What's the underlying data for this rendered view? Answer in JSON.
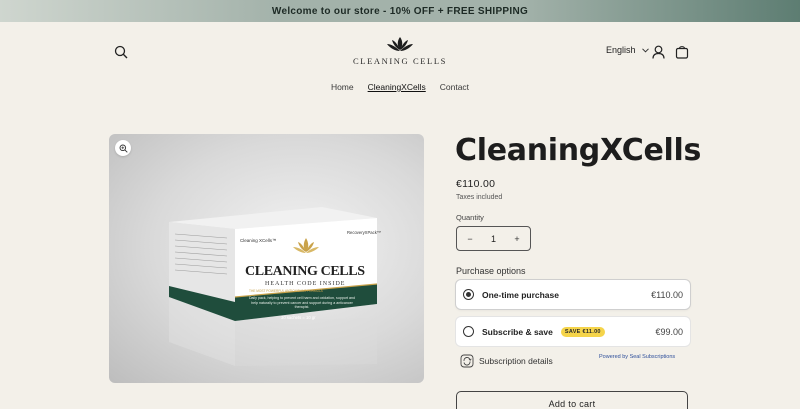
{
  "announcement": "Welcome to our store - 10% OFF + FREE SHIPPING",
  "header": {
    "logo_text": "CLEANING CELLS",
    "language": "English"
  },
  "nav": {
    "items": [
      {
        "label": "Home"
      },
      {
        "label": "CleaningXCells"
      },
      {
        "label": "Contact"
      }
    ],
    "active_index": 1
  },
  "product": {
    "title": "CleaningXCells",
    "price": "€110.00",
    "taxes_note": "Taxes included",
    "quantity_label": "Quantity",
    "quantity": "1",
    "decrease_symbol": "−",
    "increase_symbol": "+",
    "image": {
      "brand_small": "Cleaning XCells™",
      "pack_name": "RecoveryXPack™",
      "main_name": "CLEANING CELLS",
      "subtitle": "HEALTH CODE INSIDE",
      "tagline": "THE MOST POWERFUL ANTIOXIDANT FORMULA",
      "description": "Daily pack, helping to prevent cell harm and oxidation, support and help naturally to prevent cancer and support during a anticancer therapist.",
      "contents": "30 sachets = 10 gr"
    }
  },
  "purchase_options": {
    "label": "Purchase options",
    "one_time": {
      "name": "One-time purchase",
      "price": "€110.00",
      "selected": true
    },
    "subscribe": {
      "name": "Subscribe & save",
      "badge": "SAVE €11.00",
      "price": "€99.00",
      "selected": false
    },
    "subscription_details": "Subscription details",
    "powered_by": "Powered by Seal Subscriptions"
  },
  "add_to_cart": "Add to cart",
  "colors": {
    "background": "#f3f0e9",
    "brand_green": "#1f4d3c",
    "gold": "#c9a24a",
    "badge_yellow": "#f5d44a",
    "link_blue": "#2d4e9a"
  }
}
